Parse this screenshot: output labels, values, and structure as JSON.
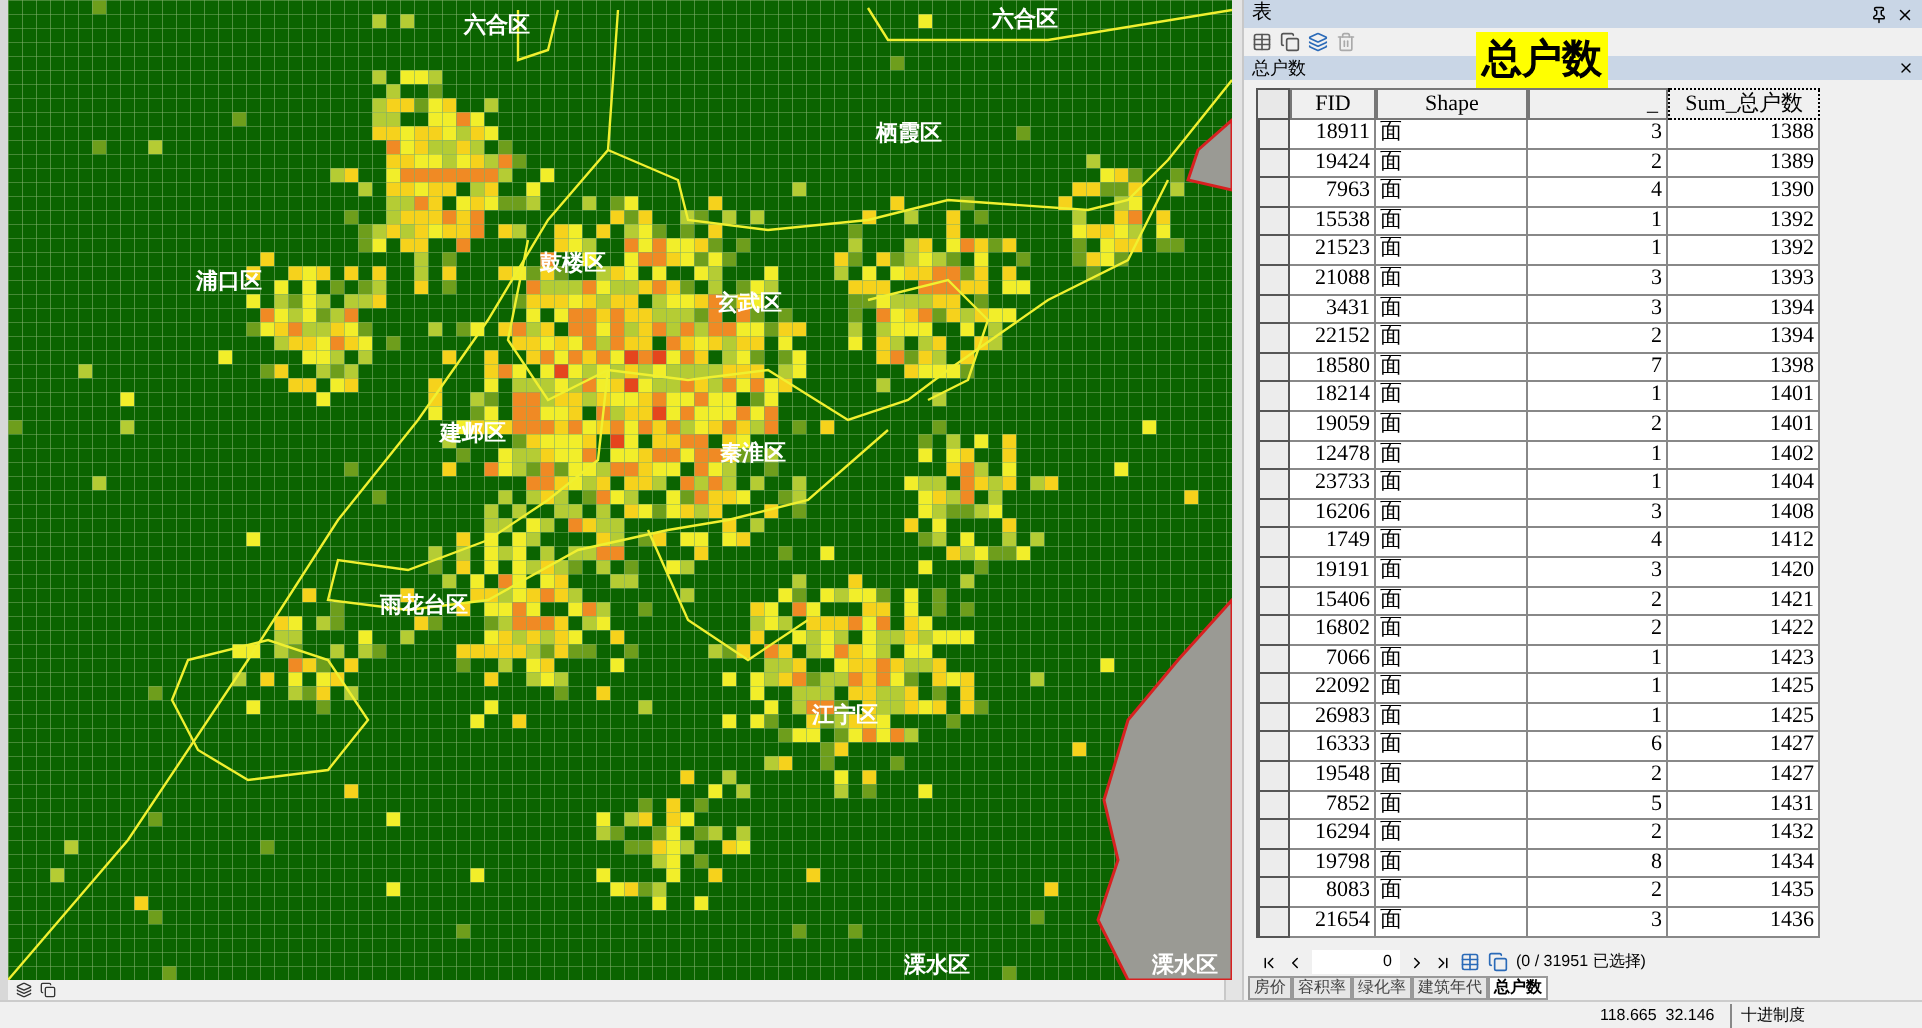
{
  "map": {
    "labels": [
      "六合区",
      "六合区",
      "栖霞区",
      "浦口区",
      "鼓楼区",
      "玄武区",
      "建邺区",
      "秦淮区",
      "雨花台区",
      "江宁区",
      "溧水区",
      "溧水区"
    ]
  },
  "window": {
    "title": "表"
  },
  "table_title": "总户数",
  "callout": "总户数",
  "table": {
    "columns": [
      "FID",
      "Shape",
      "_",
      "Sum_总户数"
    ],
    "rows": [
      [
        "18911",
        "面",
        "3",
        "1388"
      ],
      [
        "19424",
        "面",
        "2",
        "1389"
      ],
      [
        "7963",
        "面",
        "4",
        "1390"
      ],
      [
        "15538",
        "面",
        "1",
        "1392"
      ],
      [
        "21523",
        "面",
        "1",
        "1392"
      ],
      [
        "21088",
        "面",
        "3",
        "1393"
      ],
      [
        "3431",
        "面",
        "3",
        "1394"
      ],
      [
        "22152",
        "面",
        "2",
        "1394"
      ],
      [
        "18580",
        "面",
        "7",
        "1398"
      ],
      [
        "18214",
        "面",
        "1",
        "1401"
      ],
      [
        "19059",
        "面",
        "2",
        "1401"
      ],
      [
        "12478",
        "面",
        "1",
        "1402"
      ],
      [
        "23733",
        "面",
        "1",
        "1404"
      ],
      [
        "16206",
        "面",
        "3",
        "1408"
      ],
      [
        "1749",
        "面",
        "4",
        "1412"
      ],
      [
        "19191",
        "面",
        "3",
        "1420"
      ],
      [
        "15406",
        "面",
        "2",
        "1421"
      ],
      [
        "16802",
        "面",
        "2",
        "1422"
      ],
      [
        "7066",
        "面",
        "1",
        "1423"
      ],
      [
        "22092",
        "面",
        "1",
        "1425"
      ],
      [
        "26983",
        "面",
        "1",
        "1425"
      ],
      [
        "16333",
        "面",
        "6",
        "1427"
      ],
      [
        "19548",
        "面",
        "2",
        "1427"
      ],
      [
        "7852",
        "面",
        "5",
        "1431"
      ],
      [
        "16294",
        "面",
        "2",
        "1432"
      ],
      [
        "19798",
        "面",
        "8",
        "1434"
      ],
      [
        "8083",
        "面",
        "2",
        "1435"
      ],
      [
        "21654",
        "面",
        "3",
        "1436"
      ]
    ]
  },
  "navigator": {
    "record": "0",
    "selection": "(0 / 31951 已选择)"
  },
  "tabs": [
    {
      "label": "房价",
      "selected": false
    },
    {
      "label": "容积率",
      "selected": false
    },
    {
      "label": "绿化率",
      "selected": false
    },
    {
      "label": "建筑年代",
      "selected": false
    },
    {
      "label": "总户数",
      "selected": true
    }
  ],
  "status_bar": {
    "coordinates": "118.665  32.146",
    "units": "十进制度"
  }
}
